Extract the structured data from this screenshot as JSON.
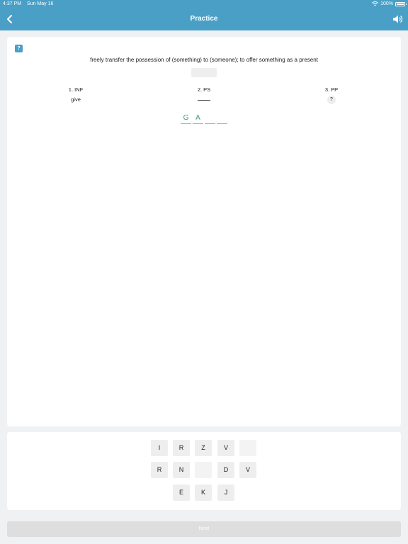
{
  "status_bar": {
    "time": "4:37 PM",
    "date": "Sun May 16",
    "battery": "100%"
  },
  "nav": {
    "title": "Practice",
    "back_icon": "chevron-left-icon",
    "sound_icon": "speaker-icon"
  },
  "card": {
    "hint_icon_glyph": "?",
    "definition": "freely transfer the possession of (something) to (someone); to offer something as a present",
    "forms": [
      {
        "label": "1. INF",
        "value": "give"
      },
      {
        "label": "2. PS",
        "value": ""
      },
      {
        "label": "3. PP",
        "value": "?"
      }
    ],
    "answer_letters": [
      "G",
      "A",
      "",
      ""
    ]
  },
  "keyboard": {
    "rows": [
      [
        "I",
        "R",
        "Z",
        "V",
        ""
      ],
      [
        "R",
        "N",
        "",
        "D",
        "V"
      ],
      [
        "E",
        "K",
        "J"
      ]
    ]
  },
  "next_button": {
    "label": "Next"
  },
  "colors": {
    "header": "#4a9fc6",
    "answer_text": "#2f9e7a"
  }
}
